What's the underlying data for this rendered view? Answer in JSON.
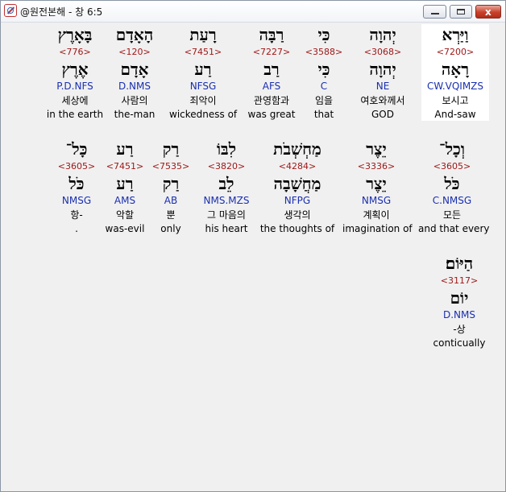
{
  "window": {
    "title": "@원전본해 - 창 6:5",
    "minimize_label": "",
    "maximize_label": "",
    "close_label": "x"
  },
  "words": [
    {
      "hebrew": "וַיַּרְא",
      "strong": "<7200>",
      "lemma": "רָאָה",
      "morph": "CW.VQIMZS",
      "korean": "보시고",
      "english": "And-saw"
    },
    {
      "hebrew": "יְהוָה",
      "strong": "<3068>",
      "lemma": "יְהוָה",
      "morph": "NE",
      "korean": "여호와께서",
      "english": "GOD"
    },
    {
      "hebrew": "כִּי",
      "strong": "<3588>",
      "lemma": "כִּי",
      "morph": "C",
      "korean": "임을",
      "english": "that"
    },
    {
      "hebrew": "רַבָּה",
      "strong": "<7227>",
      "lemma": "רַב",
      "morph": "AFS",
      "korean": "관영함과",
      "english": "was great"
    },
    {
      "hebrew": "רָעַת",
      "strong": "<7451>",
      "lemma": "רַע",
      "morph": "NFSG",
      "korean": "죄악이",
      "english": "wickedness of"
    },
    {
      "hebrew": "הָאָדָם",
      "strong": "<120>",
      "lemma": "אָדָם",
      "morph": "D.NMS",
      "korean": "사람의",
      "english": "the-man"
    },
    {
      "hebrew": "בָּאָרֶץ",
      "strong": "<776>",
      "lemma": "אֶרֶץ",
      "morph": "P.D.NFS",
      "korean": "세상에",
      "english": "in the earth"
    },
    {
      "hebrew": "וְכָל־",
      "strong": "<3605>",
      "lemma": "כֹּל",
      "morph": "C.NMSG",
      "korean": "모든",
      "english": "and that every"
    },
    {
      "hebrew": "יֵצֶר",
      "strong": "<3336>",
      "lemma": "יֵצֶר",
      "morph": "NMSG",
      "korean": "계획이",
      "english": "imagination of"
    },
    {
      "hebrew": "מַחְשְׁבֹת",
      "strong": "<4284>",
      "lemma": "מַחֲשָׁבָה",
      "morph": "NFPG",
      "korean": "생각의",
      "english": "the thoughts of"
    },
    {
      "hebrew": "לִבּוֹ",
      "strong": "<3820>",
      "lemma": "לֵב",
      "morph": "NMS.MZS",
      "korean": "그 마음의",
      "english": "his heart"
    },
    {
      "hebrew": "רַק",
      "strong": "<7535>",
      "lemma": "רַק",
      "morph": "AB",
      "korean": "뿐",
      "english": "only"
    },
    {
      "hebrew": "רַע",
      "strong": "<7451>",
      "lemma": "רַע",
      "morph": "AMS",
      "korean": "악할",
      "english": "was-evil"
    },
    {
      "hebrew": "כָּל־",
      "strong": "<3605>",
      "lemma": "כֹּל",
      "morph": "NMSG",
      "korean": "항-",
      "english": "."
    },
    {
      "hebrew": "הַיּוֹם׃",
      "strong": "<3117>",
      "lemma": "יוֹם",
      "morph": "D.NMS",
      "korean": "-상",
      "english": "conticually"
    }
  ]
}
